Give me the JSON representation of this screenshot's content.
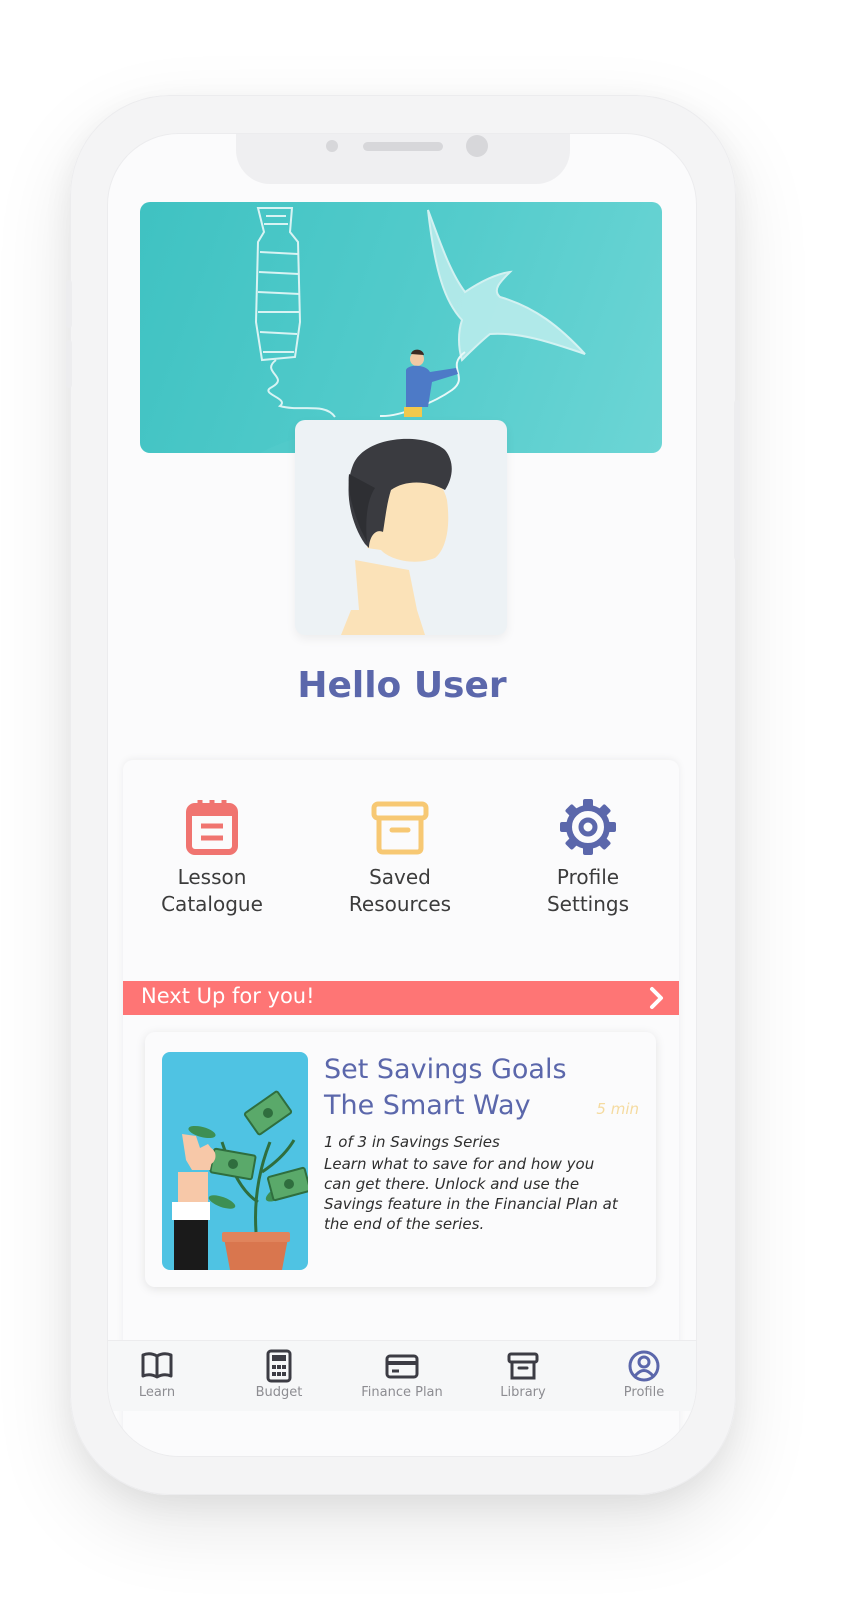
{
  "greeting": "Hello User",
  "quick_actions": [
    {
      "label": "Lesson\nCatalogue",
      "icon": "notepad-icon",
      "color": "#f07470"
    },
    {
      "label": "Saved\nResources",
      "icon": "archive-box-icon",
      "color": "#f7c873"
    },
    {
      "label": "Profile\nSettings",
      "icon": "gear-icon",
      "color": "#5b67ab"
    }
  ],
  "next_up": {
    "title": "Next Up for you!",
    "lesson": {
      "title": "Set Savings Goals\nThe Smart Way",
      "duration": "5 min",
      "series": "1 of 3 in Savings Series",
      "description": "Learn what to save for and how you can get there. Unlock and use the Savings feature in the Financial Plan at the end of the series."
    }
  },
  "tabs": [
    {
      "label": "Learn",
      "icon": "book-icon"
    },
    {
      "label": "Budget",
      "icon": "calculator-icon"
    },
    {
      "label": "Finance Plan",
      "icon": "credit-card-icon"
    },
    {
      "label": "Library",
      "icon": "archive-icon"
    },
    {
      "label": "Profile",
      "icon": "user-circle-icon",
      "active": true
    }
  ],
  "colors": {
    "primary": "#5b67ab",
    "accent": "#fe7575",
    "hero": "#4cc9c9",
    "duration": "#f5dba0"
  }
}
